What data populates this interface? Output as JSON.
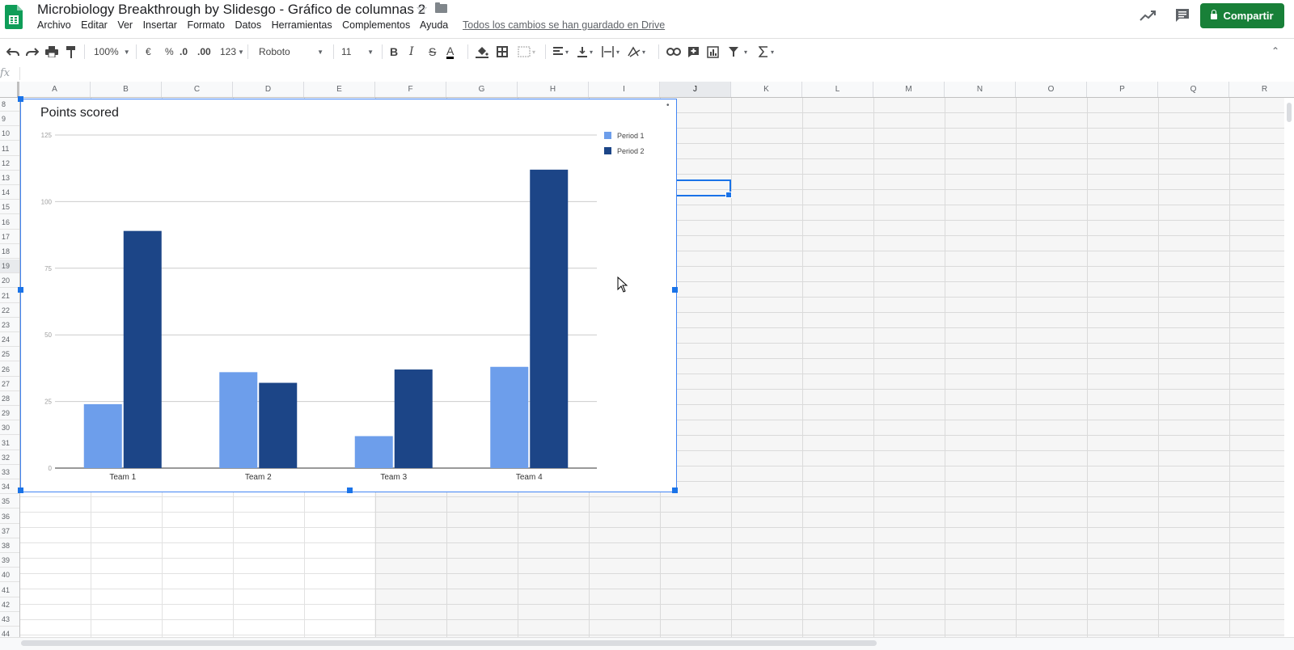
{
  "header": {
    "title": "Microbiology Breakthrough by Slidesgo - Gráfico de columnas 2",
    "save_status": "Todos los cambios se han guardado en Drive",
    "share_label": "Compartir",
    "menu": [
      "Archivo",
      "Editar",
      "Ver",
      "Insertar",
      "Formato",
      "Datos",
      "Herramientas",
      "Complementos",
      "Ayuda"
    ]
  },
  "toolbar": {
    "zoom": "100%",
    "currency": "€",
    "percent": "%",
    "decimal_decrease": ".0",
    "decimal_increase": ".00",
    "number_format": "123",
    "font": "Roboto",
    "font_size": "11"
  },
  "formula_bar": {
    "fx": "fx"
  },
  "grid": {
    "columns": [
      "A",
      "B",
      "C",
      "D",
      "E",
      "F",
      "G",
      "H",
      "I",
      "J",
      "K",
      "L",
      "M",
      "N",
      "O",
      "P",
      "Q",
      "R"
    ],
    "rows": [
      "8",
      "9",
      "10",
      "11",
      "12",
      "13",
      "14",
      "15",
      "16",
      "17",
      "18",
      "19",
      "20",
      "21",
      "22",
      "23",
      "24",
      "25",
      "26",
      "27",
      "28",
      "29",
      "30",
      "31",
      "32",
      "33",
      "34",
      "35",
      "36",
      "37",
      "38",
      "39",
      "40",
      "41",
      "42",
      "43",
      "44"
    ],
    "selected_column": "J",
    "selected_row": "19"
  },
  "chart_data": {
    "type": "bar",
    "title": "Points scored",
    "categories": [
      "Team 1",
      "Team 2",
      "Team 3",
      "Team 4"
    ],
    "series": [
      {
        "name": "Period 1",
        "values": [
          24,
          36,
          12,
          38
        ],
        "color": "#6d9eeb"
      },
      {
        "name": "Period 2",
        "values": [
          89,
          32,
          37,
          112
        ],
        "color": "#1c4587"
      }
    ],
    "ylim": [
      0,
      125
    ],
    "yticks": [
      "0",
      "25",
      "50",
      "75",
      "100",
      "125"
    ],
    "grid": true,
    "legend": "top-right"
  }
}
